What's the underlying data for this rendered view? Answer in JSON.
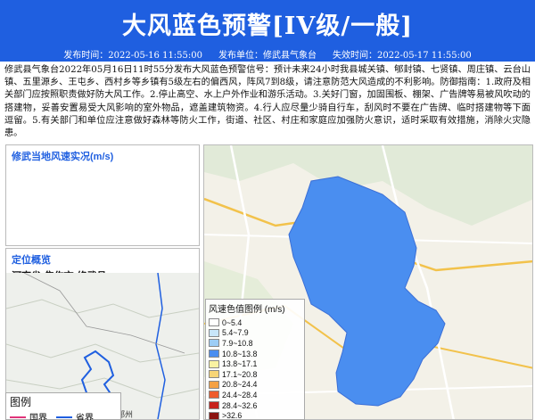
{
  "header": {
    "title": "大风蓝色预警[IV级/一般]",
    "publish_time": "发布时间：2022-05-16 11:55:00",
    "publisher": "发布单位：修武县气象台",
    "expire_time": "失效时间：2022-05-17 11:55:00"
  },
  "description": "修武县气象台2022年05月16日11时55分发布大风蓝色预警信号：预计未来24小时我县城关镇、郇封镇、七贤镇、周庄镇、云台山镇、五里源乡、王屯乡、西村乡等乡镇有5级左右的偏西风，阵风7到8级，请注意防范大风造成的不利影响。防御指南：1.政府及相关部门应按照职责做好防大风工作。2.停止高空、水上户外作业和游乐活动。3.关好门窗，加固围板、棚架、广告牌等易被风吹动的搭建物，妥善安置易受大风影响的室外物品，遮盖建筑物资。4.行人应尽量少骑自行车，刮风时不要在广告牌、临时搭建物等下面逗留。5.有关部门和单位应注意做好森林等防火工作，街道、社区、村庄和家庭应加强防火意识，适时采取有效措施，消除火灾隐患。",
  "wind_panel": {
    "title": "修武当地风速实况(m/s)"
  },
  "location_panel": {
    "title": "定位概览",
    "location": "河南省-焦作市-修武县",
    "map_label": "郑州",
    "legend": {
      "title": "图例",
      "items": [
        {
          "label": "国界",
          "color": "#e0347a"
        },
        {
          "label": "省界",
          "color": "#1f5fe0"
        }
      ]
    }
  },
  "map_legend": {
    "title": "风速色值图例 (m/s)",
    "items": [
      {
        "label": "0~5.4",
        "color": "#ffffff"
      },
      {
        "label": "5.4~7.9",
        "color": "#c8e6fa"
      },
      {
        "label": "7.9~10.8",
        "color": "#9dcdf5"
      },
      {
        "label": "10.8~13.8",
        "color": "#4a8ef0"
      },
      {
        "label": "13.8~17.1",
        "color": "#f9f2a2"
      },
      {
        "label": "17.1~20.8",
        "color": "#f7d577"
      },
      {
        "label": "20.8~24.4",
        "color": "#f5a144"
      },
      {
        "label": "24.4~28.4",
        "color": "#ee5b2c"
      },
      {
        "label": "28.4~32.6",
        "color": "#c7221c"
      },
      {
        "label": ">32.6",
        "color": "#8b1310"
      }
    ]
  },
  "alert_area_color": "#4a8ef0"
}
